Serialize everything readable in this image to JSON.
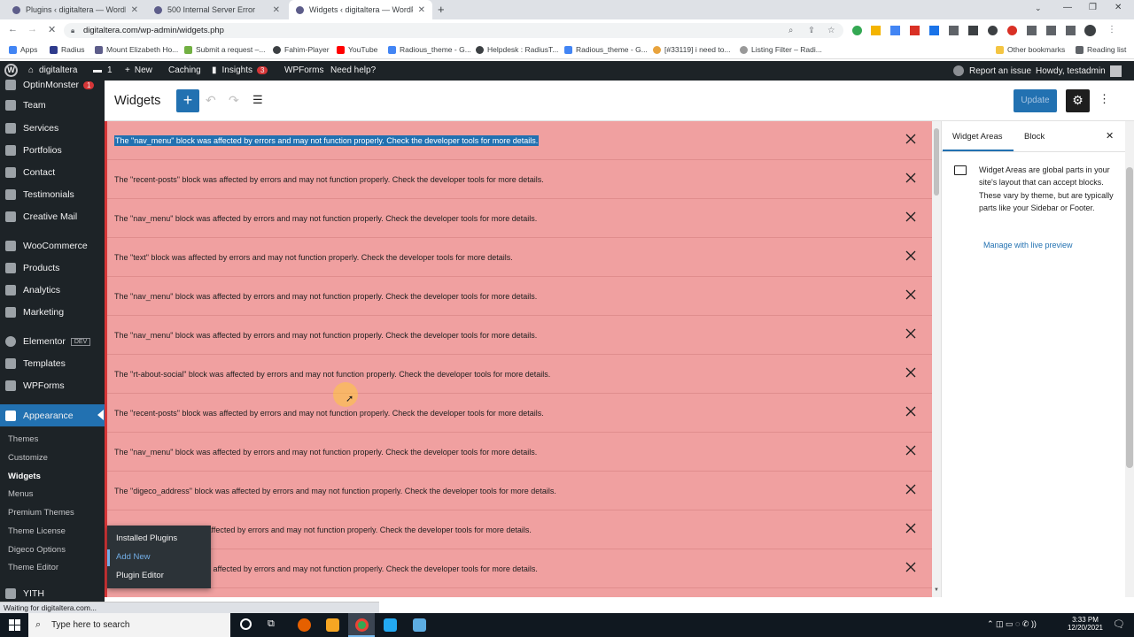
{
  "browser": {
    "tabs": [
      {
        "title": "Plugins ‹ digitaltera — WordPres",
        "active": false
      },
      {
        "title": "500 Internal Server Error",
        "active": false
      },
      {
        "title": "Widgets ‹ digitaltera — WordPre",
        "active": true
      }
    ],
    "new_tab": "+",
    "url": "digitaltera.com/wp-admin/widgets.php",
    "bookmarks": [
      "Apps",
      "Radius",
      "Mount Elizabeth Ho...",
      "Submit a request –...",
      "Fahim-Player",
      "YouTube",
      "Radious_theme - G...",
      "Helpdesk : RadiusT...",
      "Radious_theme - G...",
      "[#33119] i need to...",
      "Listing Filter – Radi..."
    ],
    "other_bookmarks": "Other bookmarks",
    "reading_list": "Reading list"
  },
  "adminbar": {
    "site": "digitaltera",
    "comments": "1",
    "new": "New",
    "caching": "Caching",
    "insights": "Insights",
    "insights_badge": "3",
    "wpforms": "WPForms",
    "help": "Need help?",
    "report": "Report an issue",
    "howdy": "Howdy, testadmin"
  },
  "sidebar": {
    "items": [
      {
        "label": "OptinMonster",
        "badge": "1"
      },
      {
        "label": "Team"
      },
      {
        "label": "Services"
      },
      {
        "label": "Portfolios"
      },
      {
        "label": "Contact"
      },
      {
        "label": "Testimonials"
      },
      {
        "label": "Creative Mail"
      },
      {
        "label": "WooCommerce"
      },
      {
        "label": "Products"
      },
      {
        "label": "Analytics"
      },
      {
        "label": "Marketing"
      },
      {
        "label": "Elementor",
        "badge": "DEV"
      },
      {
        "label": "Templates"
      },
      {
        "label": "WPForms"
      },
      {
        "label": "Appearance"
      }
    ],
    "submenu": [
      "Themes",
      "Customize",
      "Widgets",
      "Menus",
      "Premium Themes",
      "Theme License",
      "Digeco Options",
      "Theme Editor"
    ],
    "bottom": "YITH"
  },
  "flyout": [
    "Installed Plugins",
    "Add New",
    "Plugin Editor"
  ],
  "editor": {
    "title": "Widgets",
    "update": "Update",
    "errors": [
      "The \"nav_menu\" block was affected by errors and may not function properly. Check the developer tools for more details.",
      "The \"recent-posts\" block was affected by errors and may not function properly. Check the developer tools for more details.",
      "The \"nav_menu\" block was affected by errors and may not function properly. Check the developer tools for more details.",
      "The \"text\" block was affected by errors and may not function properly. Check the developer tools for more details.",
      "The \"nav_menu\" block was affected by errors and may not function properly. Check the developer tools for more details.",
      "The \"nav_menu\" block was affected by errors and may not function properly. Check the developer tools for more details.",
      "The \"rt-about-social\" block was affected by errors and may not function properly. Check the developer tools for more details.",
      "The \"recent-posts\" block was affected by errors and may not function properly. Check the developer tools for more details.",
      "The \"nav_menu\" block was affected by errors and may not function properly. Check the developer tools for more details.",
      "The \"digeco_address\" block was affected by errors and may not function properly. Check the developer tools for more details.",
      "was affected by errors and may not function properly. Check the developer tools for more details.",
      "k was affected by errors and may not function properly. Check the developer tools for more details."
    ]
  },
  "panel": {
    "tab_areas": "Widget Areas",
    "tab_block": "Block",
    "description": "Widget Areas are global parts in your site's layout that can accept blocks. These vary by theme, but are typically parts like your Sidebar or Footer.",
    "manage_link": "Manage with live preview"
  },
  "status": "Waiting for digitaltera.com...",
  "taskbar": {
    "search_placeholder": "Type here to search",
    "time": "3:33 PM",
    "date": "12/20/2021"
  },
  "colors": {
    "admin_dark": "#1d2327",
    "accent_blue": "#2271b1",
    "error_bg": "#f0a0a0",
    "error_border": "#d63638"
  }
}
